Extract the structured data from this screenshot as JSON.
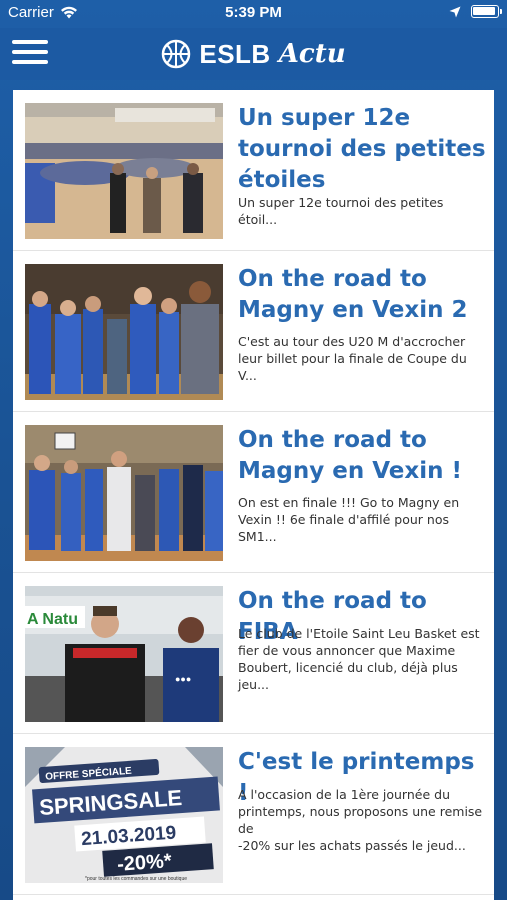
{
  "status_bar": {
    "carrier": "Carrier",
    "time": "5:39 PM"
  },
  "header": {
    "brand": "ESLB",
    "brand_sub": "Actu"
  },
  "articles": [
    {
      "title_lines": [
        "Un super 12e",
        "tournoi des petites",
        "étoiles"
      ],
      "excerpt_lines": [
        "Un super 12e tournoi des petites étoil..."
      ]
    },
    {
      "title_lines": [
        "On the road to",
        "Magny en Vexin 2"
      ],
      "excerpt_lines": [
        "C'est au tour des U20 M d'accrocher",
        "leur billet pour la finale de Coupe du V..."
      ]
    },
    {
      "title_lines": [
        "On the road to",
        "Magny en Vexin !"
      ],
      "excerpt_lines": [
        "On est en finale !!! Go to Magny en",
        "Vexin !! 6e finale d'affilé pour nos SM1..."
      ]
    },
    {
      "title_lines": [
        "On the road to FIBA"
      ],
      "excerpt_lines": [
        "Le club de l'Etoile Saint Leu Basket est",
        "fier de vous annoncer que Maxime",
        "Boubert, licencié du club, déjà plus jeu..."
      ]
    },
    {
      "title_lines": [
        "C'est le printemps !"
      ],
      "excerpt_lines": [
        "A l'occasion de la 1ère journée du",
        "printemps, nous proposons une remise de",
        "-20% sur les achats passés le jeud..."
      ]
    }
  ],
  "promo_image": {
    "badge": "OFFRE SPÉCIALE",
    "headline": "SPRINGSALE",
    "date": "21.03.2019",
    "discount": "-20%*",
    "footnote": "*pour toutes les commandes sur une boutique"
  },
  "photo_text": {
    "banner": "A Natu"
  },
  "colors": {
    "brand_blue": "#1c5aa3",
    "title_blue": "#2a6ab1"
  }
}
